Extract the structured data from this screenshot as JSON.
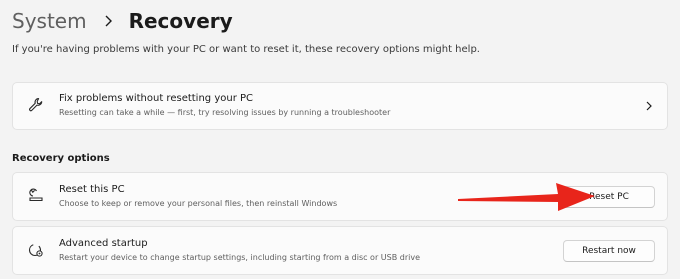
{
  "breadcrumb": {
    "parent": "System",
    "separator_icon": "chevron-right-icon",
    "current": "Recovery"
  },
  "intro_text": "If you're having problems with your PC or want to reset it, these recovery options might help.",
  "troubleshoot_card": {
    "icon": "wrench-icon",
    "title": "Fix problems without resetting your PC",
    "description": "Resetting can take a while — first, try resolving issues by running a troubleshooter",
    "chevron_icon": "chevron-right-icon"
  },
  "recovery_options": {
    "header": "Recovery options",
    "reset": {
      "icon": "reset-pc-icon",
      "title": "Reset this PC",
      "description": "Choose to keep or remove your personal files, then reinstall Windows",
      "button_label": "Reset PC"
    },
    "advanced": {
      "icon": "advanced-startup-icon",
      "title": "Advanced startup",
      "description": "Restart your device to change startup settings, including starting from a disc or USB drive",
      "button_label": "Restart now"
    }
  },
  "annotation": {
    "arrow_color": "#e8251b"
  }
}
